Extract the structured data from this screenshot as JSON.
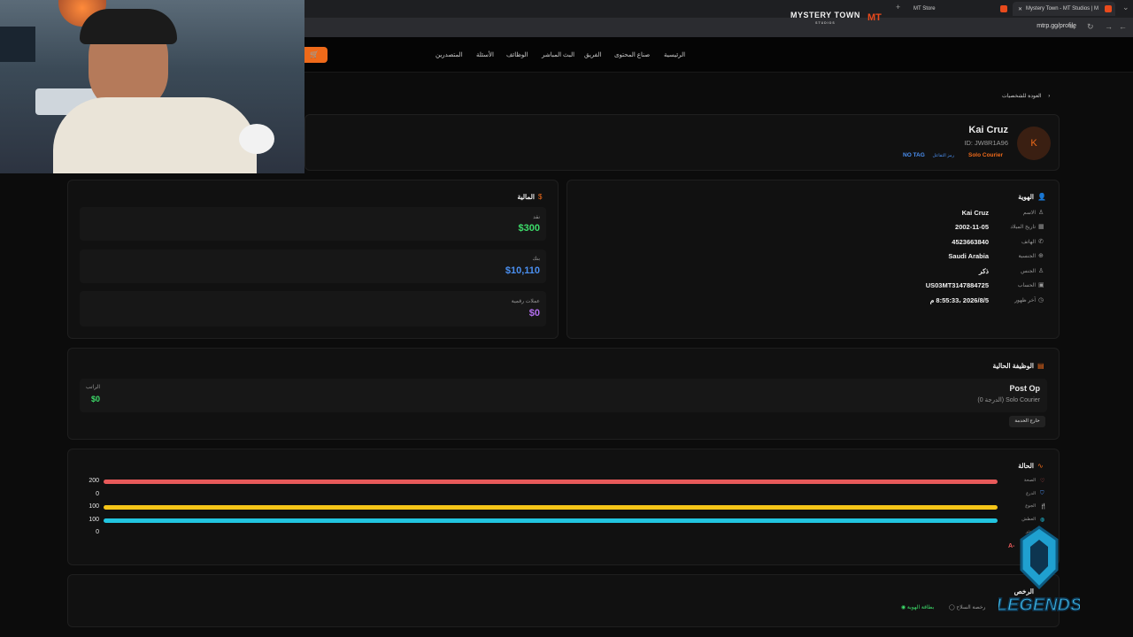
{
  "browser": {
    "tabs": [
      {
        "label": "MT Store"
      },
      {
        "label": "Mystery Town - MT Studios | M"
      }
    ],
    "url": "mtrp.gg/profile"
  },
  "header": {
    "logo_text": "MYSTERY TOWN",
    "logo_sub": "STUDIOS",
    "logo_mark": "MT",
    "nav": [
      "الرئيسية",
      "صناع المحتوى",
      "الفريق",
      "البث المباشر",
      "الوظائف",
      "الأسئلة",
      "المتصدرين"
    ],
    "store_icon": "cart-icon"
  },
  "back": {
    "label": "العودة للشخصيات"
  },
  "profile": {
    "avatar_letter": "K",
    "name": "Kai Cruz",
    "id": "ID: JW8R1A96",
    "job_badge": "Solo Courier",
    "group_tag_label": "رمز التفاعل",
    "group_tag_value": "NO TAG"
  },
  "identity": {
    "title": "الهوية",
    "rows": [
      {
        "label": "الاسم",
        "value": "Kai Cruz",
        "icon": "user-icon"
      },
      {
        "label": "تاريخ الميلاد",
        "value": "2002-11-05",
        "icon": "calendar-icon"
      },
      {
        "label": "الهاتف",
        "value": "4523663840",
        "icon": "phone-icon"
      },
      {
        "label": "الجنسية",
        "value": "Saudi Arabia",
        "icon": "globe-icon"
      },
      {
        "label": "الجنس",
        "value": "ذكر",
        "icon": "user-icon"
      },
      {
        "label": "الحساب",
        "value": "US03MT3147884725",
        "icon": "bank-icon"
      },
      {
        "label": "آخر ظهور",
        "value": "2026/8/5 ،8:55:33 م",
        "icon": "clock-icon"
      }
    ]
  },
  "finance": {
    "title": "المالية",
    "items": [
      {
        "label": "نقد",
        "value": "$300",
        "color": "#3ddc6a"
      },
      {
        "label": "بنك",
        "value": "$10,110",
        "color": "#4a8ff0"
      },
      {
        "label": "عملات رقمية",
        "value": "$0",
        "color": "#b46ff0"
      }
    ]
  },
  "job": {
    "title": "الوظيفة الحالية",
    "name": "Post Op",
    "grade": "Solo Courier (الدرجة 0)",
    "duty_button": "خارج الخدمة",
    "salary_label": "الراتب",
    "salary_value": "$0"
  },
  "status": {
    "title": "الحالة",
    "stats": [
      {
        "label": "الصحة",
        "value": "200",
        "fraction": 1.0,
        "color": "#e85a5a",
        "icon": "heart-icon"
      },
      {
        "label": "الدرع",
        "value": "0",
        "fraction": 0,
        "color": "#4a8ff0",
        "icon": "shield-icon"
      },
      {
        "label": "الجوع",
        "value": "100",
        "fraction": 1.0,
        "color": "#f5c518",
        "icon": "food-icon"
      },
      {
        "label": "العطش",
        "value": "100",
        "fraction": 1.0,
        "color": "#22c5e0",
        "icon": "drink-icon"
      },
      {
        "label": "التوتر",
        "value": "0",
        "fraction": 0,
        "color": "#b46ff0",
        "icon": "stress-icon"
      }
    ],
    "blood_type": "A-"
  },
  "licenses": {
    "title": "الرخص",
    "items": [
      {
        "label": "رخصة السلاح",
        "active": false
      },
      {
        "label": "بطاقة الهوية",
        "active": true
      }
    ]
  },
  "watermark": {
    "text": "LEGENDS"
  },
  "colors": {
    "accent": "#ef6a1a",
    "background": "#0c0c0c",
    "card": "#111111"
  }
}
